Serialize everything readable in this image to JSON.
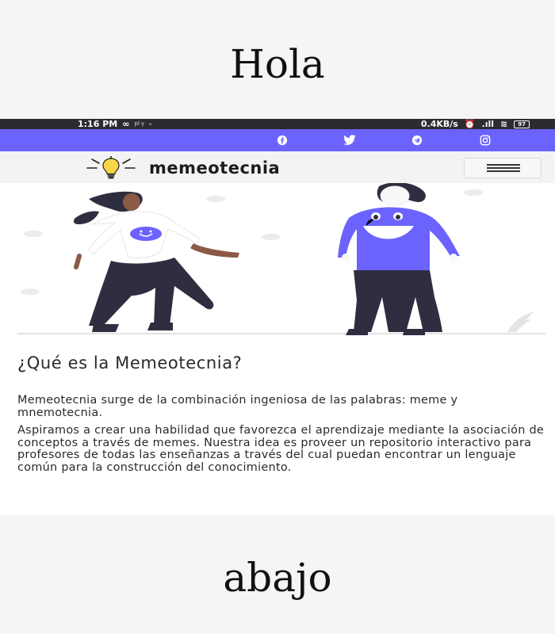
{
  "captions": {
    "top": "Hola",
    "bottom": "abajo"
  },
  "status_bar": {
    "time": "1:16 PM",
    "infinity_icon": "∞",
    "store_label": "pl·y",
    "speed": "0.4KB/s",
    "battery": "97"
  },
  "social_icons": [
    "facebook-icon",
    "twitter-icon",
    "telegram-icon",
    "instagram-icon"
  ],
  "navbar": {
    "brand": "memeotecnia",
    "logo_icon": "lightbulb-icon"
  },
  "article": {
    "heading": "¿Qué es la Memeotecnia?",
    "paragraphs": [
      "Memeotecnia surge de la combinación ingeniosa de las palabras: meme y mnemotecnia.",
      "Aspiramos a crear una habilidad que favorezca el aprendizaje mediante la asociación de conceptos a través de memes. Nuestra idea es proveer un repositorio interactivo para profesores de todas las enseñanzas a través del cual puedan encontrar un lenguaje común para la construcción del conocimiento."
    ]
  },
  "colors": {
    "accent": "#6c63ff",
    "status_bar": "#2b2b30",
    "figure_dark": "#2f2e41",
    "bulb": "#f9d648"
  }
}
